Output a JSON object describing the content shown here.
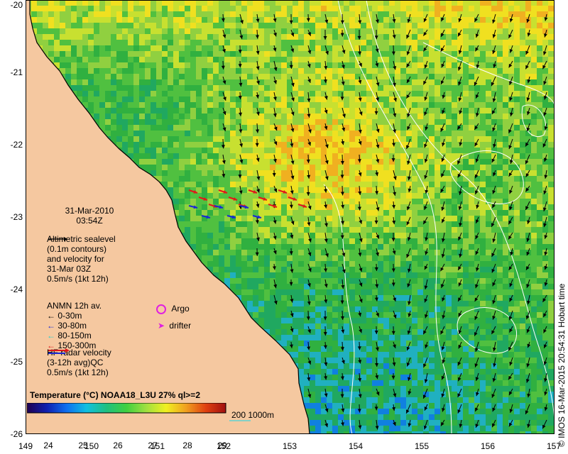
{
  "map": {
    "date": "31-Mar-2010",
    "time": "03:54Z",
    "lat_ticks": [
      "-20",
      "-21",
      "-22",
      "-23",
      "-24",
      "-25",
      "-26"
    ],
    "lon_ticks": [
      "149",
      "150",
      "151",
      "152",
      "153",
      "154",
      "155",
      "156",
      "157"
    ],
    "colors": {
      "land": "#f5c8a0",
      "coast": "#000000",
      "contour": "#ffffff",
      "arrow": "#000000",
      "bathy": "#5fd3d3",
      "hf_red": "#e0181a",
      "hf_blue": "#1a28d4",
      "argo": "#e020e0",
      "drifter": "#e020e0"
    }
  },
  "legend": {
    "altimetry": [
      "Altimetric sealevel",
      "(0.1m contours)",
      "and velocity for",
      "31-Mar 03Z",
      "0.5m/s (1kt 12h)"
    ],
    "anmn_title": "ANMN 12h av.",
    "anmn_items": [
      {
        "label": "0-30m",
        "color": "#000000"
      },
      {
        "label": "30-80m",
        "color": "#1a28d4"
      },
      {
        "label": "80-150m",
        "color": "#20d0d0"
      },
      {
        "label": "150-300m",
        "color": "#e0181a"
      }
    ],
    "argo": "Argo",
    "drifter": "drifter",
    "hf_radar": [
      "HF radar velocity",
      "(3-12h avg)QC",
      "0.5m/s (1kt 12h)"
    ],
    "bathy_label": "200  1000m"
  },
  "colorbar": {
    "title": "Temperature (°C) NOAA18_L3U 27% ql>=2",
    "ticks": [
      "24",
      "25",
      "26",
      "27",
      "28",
      "29"
    ],
    "colors": [
      "#200050",
      "#1020b0",
      "#1070f0",
      "#10c0e0",
      "#20c080",
      "#40d040",
      "#a0e040",
      "#f0f020",
      "#f0a020",
      "#e04010",
      "#a01010"
    ]
  },
  "credit": "© IMOS 16-Mar-2015 20:54:31 Hobart time"
}
